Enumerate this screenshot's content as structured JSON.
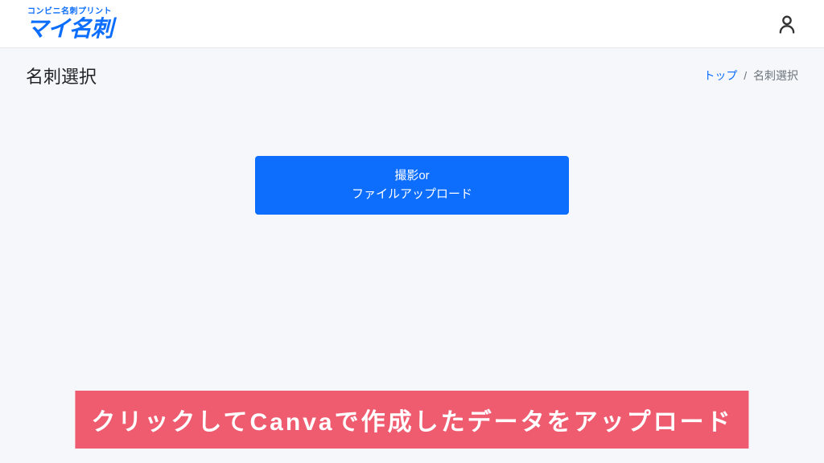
{
  "header": {
    "logo_tagline": "コンビニ名刺プリント",
    "logo_main": "マイ名刺"
  },
  "page": {
    "title": "名刺選択",
    "breadcrumb": {
      "home_label": "トップ",
      "separator": "/",
      "current": "名刺選択"
    }
  },
  "main": {
    "upload_button": {
      "line1": "撮影or",
      "line2": "ファイルアップロード"
    }
  },
  "instruction_banner": "クリックしてCanvaで作成したデータをアップロード"
}
